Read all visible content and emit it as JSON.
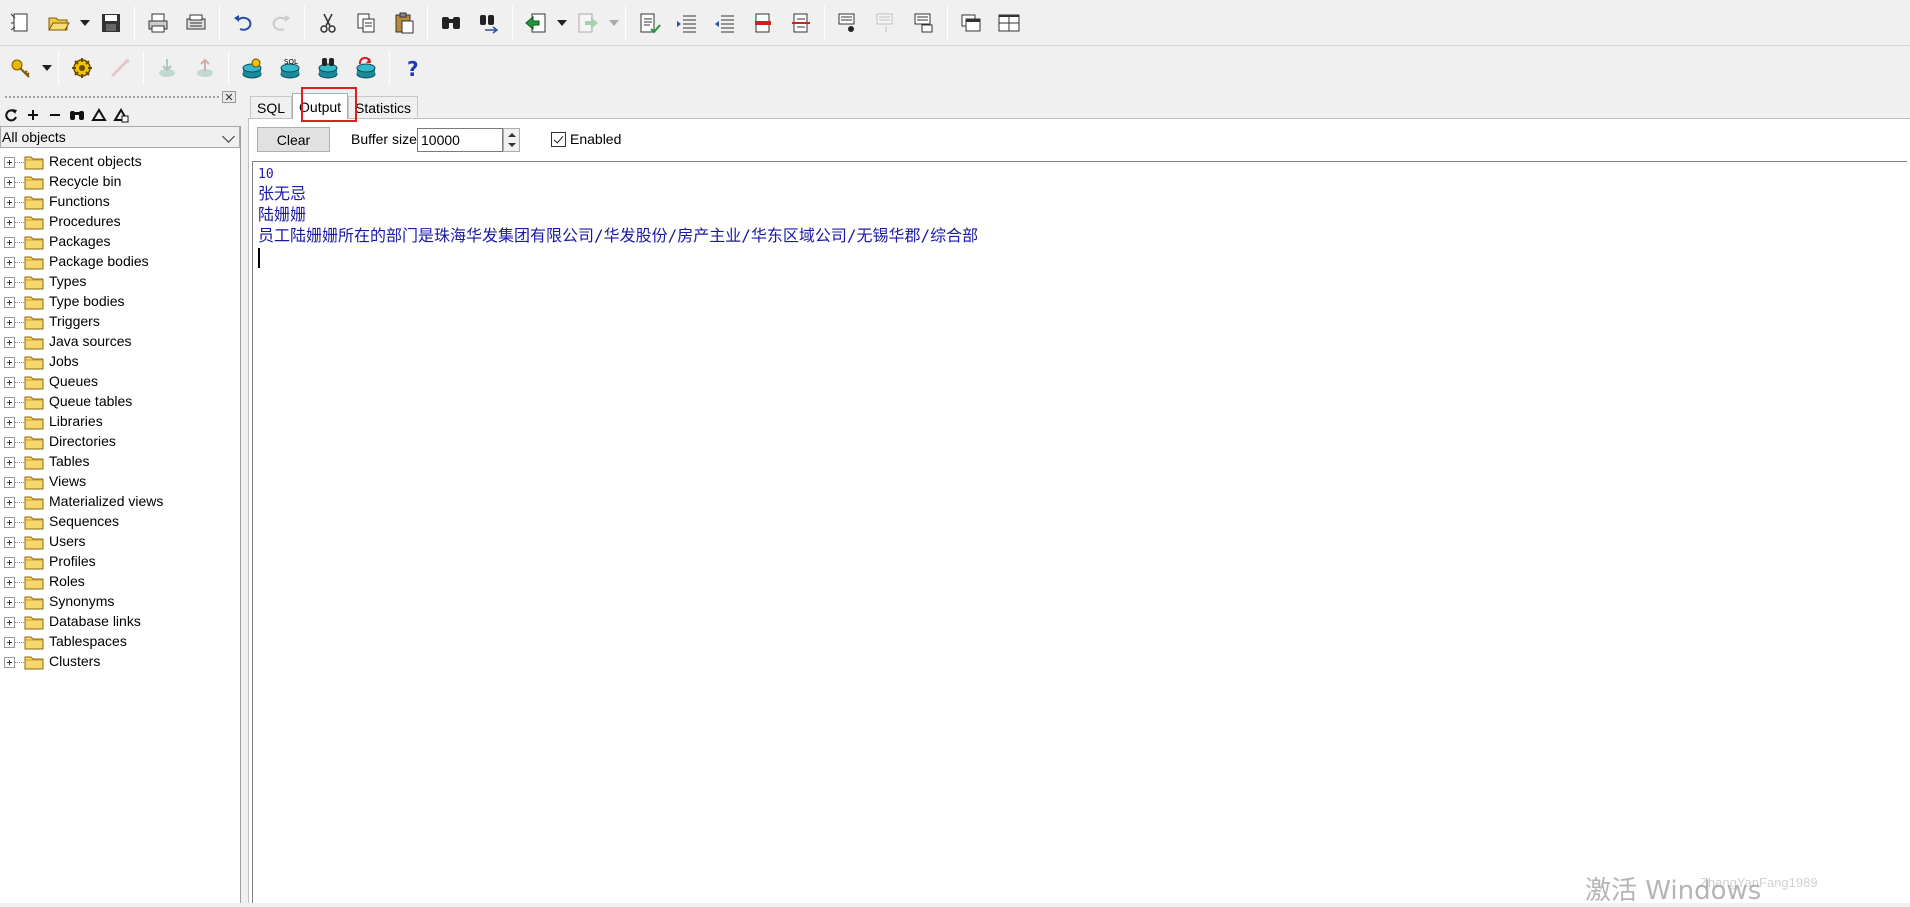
{
  "toolbar_main": {
    "buttons": [
      {
        "icon": "new-icon"
      },
      {
        "icon": "open-icon"
      },
      {
        "icon": "save-icon"
      },
      {
        "icon": "print-icon"
      },
      {
        "icon": "print-preview-icon"
      },
      {
        "icon": "undo-icon"
      },
      {
        "icon": "redo-icon"
      },
      {
        "icon": "cut-icon"
      },
      {
        "icon": "copy-icon"
      },
      {
        "icon": "paste-icon"
      },
      {
        "icon": "find-icon"
      },
      {
        "icon": "find-next-icon"
      },
      {
        "icon": "import-icon"
      },
      {
        "icon": "export-icon"
      },
      {
        "icon": "indent-icon"
      },
      {
        "icon": "unindent-icon"
      },
      {
        "icon": "comment-icon"
      },
      {
        "icon": "uncomment-icon"
      },
      {
        "icon": "format-icon"
      },
      {
        "icon": "explain-plan-icon"
      },
      {
        "icon": "debug-icon"
      },
      {
        "icon": "describe-icon"
      },
      {
        "icon": "windows-icon"
      },
      {
        "icon": "tile-icon"
      }
    ]
  },
  "toolbar_secondary": {
    "buttons": [
      {
        "icon": "key-icon"
      },
      {
        "icon": "execute-icon"
      },
      {
        "icon": "break-icon"
      },
      {
        "icon": "commit-icon"
      },
      {
        "icon": "rollback-icon"
      },
      {
        "icon": "db-connect-icon"
      },
      {
        "icon": "db-sql-icon"
      },
      {
        "icon": "db-find-icon"
      },
      {
        "icon": "db-refresh-icon"
      },
      {
        "icon": "help-icon"
      }
    ]
  },
  "object_browser": {
    "filter": "All objects",
    "items": [
      "Recent objects",
      "Recycle bin",
      "Functions",
      "Procedures",
      "Packages",
      "Package bodies",
      "Types",
      "Type bodies",
      "Triggers",
      "Java sources",
      "Jobs",
      "Queues",
      "Queue tables",
      "Libraries",
      "Directories",
      "Tables",
      "Views",
      "Materialized views",
      "Sequences",
      "Users",
      "Profiles",
      "Roles",
      "Synonyms",
      "Database links",
      "Tablespaces",
      "Clusters"
    ]
  },
  "tabs": {
    "sql": "SQL",
    "output": "Output",
    "statistics": "Statistics",
    "active": "Output"
  },
  "output_controls": {
    "clear_label": "Clear",
    "buffer_label": "Buffer size",
    "buffer_value": "10000",
    "enabled_label": "Enabled",
    "enabled": true
  },
  "output_text": {
    "lines": [
      "10",
      "张无忌",
      "陆姗姗",
      "员工陆姗姗所在的部门是珠海华发集团有限公司/华发股份/房产主业/华东区域公司/无锡华郡/综合部"
    ]
  },
  "watermark": {
    "text": "激活 Windows",
    "sub": "ZhangYanFang1989"
  },
  "colors": {
    "output_text": "#1a1aa6",
    "highlight": "#e02020"
  }
}
